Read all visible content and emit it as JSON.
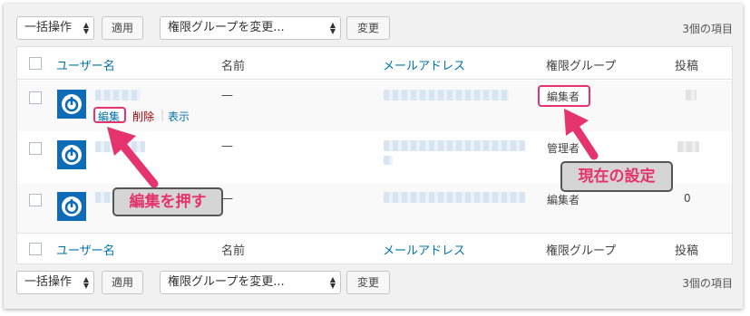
{
  "top_bar": {
    "bulk_select": "一括操作",
    "apply_button": "適用",
    "role_select": "権限グループを変更...",
    "change_button": "変更",
    "count": "3個の項目"
  },
  "bottom_bar": {
    "bulk_select": "一括操作",
    "apply_button": "適用",
    "role_select": "権限グループを変更...",
    "change_button": "変更",
    "count": "3個の項目"
  },
  "columns": {
    "username": "ユーザー名",
    "name": "名前",
    "email": "メールアドレス",
    "role": "権限グループ",
    "posts": "投稿"
  },
  "rows": [
    {
      "name": "—",
      "role": "編集者",
      "posts": "",
      "actions": {
        "edit": "編集",
        "delete": "削除",
        "sep": "|",
        "view": "表示"
      }
    },
    {
      "name": "—",
      "role": "管理者",
      "posts": ""
    },
    {
      "name": "—",
      "role": "編集者",
      "posts": "0"
    }
  ],
  "annotations": {
    "push_edit": "編集を押す",
    "current_setting": "現在の設定"
  },
  "colors": {
    "link": "#0073aa",
    "annotation": "#e5336e",
    "avatar": "#0e6bb8"
  }
}
